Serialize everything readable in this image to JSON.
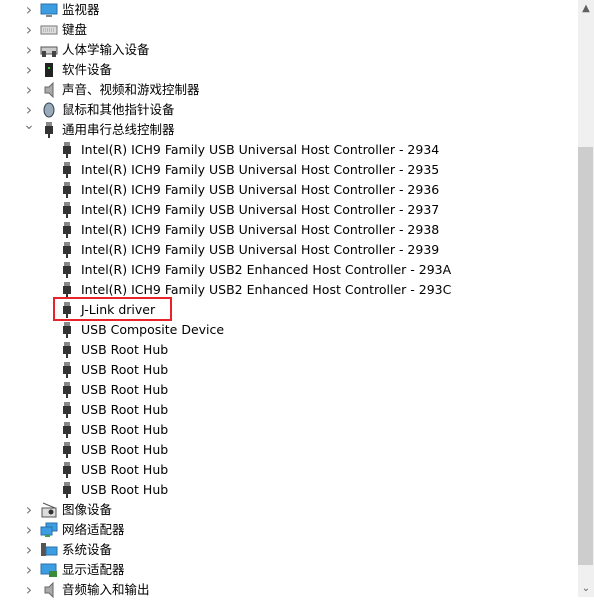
{
  "categories_top": [
    {
      "label": "监视器",
      "icon": "monitor-icon",
      "expanded": false
    },
    {
      "label": "键盘",
      "icon": "keyboard-icon",
      "expanded": false
    },
    {
      "label": "人体学输入设备",
      "icon": "hid-icon",
      "expanded": false
    },
    {
      "label": "软件设备",
      "icon": "software-device-icon",
      "expanded": false
    },
    {
      "label": "声音、视频和游戏控制器",
      "icon": "speaker-icon",
      "expanded": false
    },
    {
      "label": "鼠标和其他指针设备",
      "icon": "mouse-icon",
      "expanded": false
    },
    {
      "label": "通用串行总线控制器",
      "icon": "usb-icon",
      "expanded": true
    }
  ],
  "usb_devices": [
    "Intel(R) ICH9 Family USB Universal Host Controller - 2934",
    "Intel(R) ICH9 Family USB Universal Host Controller - 2935",
    "Intel(R) ICH9 Family USB Universal Host Controller - 2936",
    "Intel(R) ICH9 Family USB Universal Host Controller - 2937",
    "Intel(R) ICH9 Family USB Universal Host Controller - 2938",
    "Intel(R) ICH9 Family USB Universal Host Controller - 2939",
    "Intel(R) ICH9 Family USB2 Enhanced Host Controller - 293A",
    "Intel(R) ICH9 Family USB2 Enhanced Host Controller - 293C",
    "J-Link driver",
    "USB Composite Device",
    "USB Root Hub",
    "USB Root Hub",
    "USB Root Hub",
    "USB Root Hub",
    "USB Root Hub",
    "USB Root Hub",
    "USB Root Hub",
    "USB Root Hub"
  ],
  "highlighted_device": "J-Link driver",
  "highlight_color": "#e8242a",
  "categories_bottom": [
    {
      "label": "图像设备",
      "icon": "camera-icon",
      "expanded": false
    },
    {
      "label": "网络适配器",
      "icon": "network-adapter-icon",
      "expanded": false
    },
    {
      "label": "系统设备",
      "icon": "system-device-icon",
      "expanded": false
    },
    {
      "label": "显示适配器",
      "icon": "display-adapter-icon",
      "expanded": false
    },
    {
      "label": "音频输入和输出",
      "icon": "speaker-icon",
      "expanded": false
    }
  ],
  "scrollbar": {
    "position_fraction": 0.35
  }
}
